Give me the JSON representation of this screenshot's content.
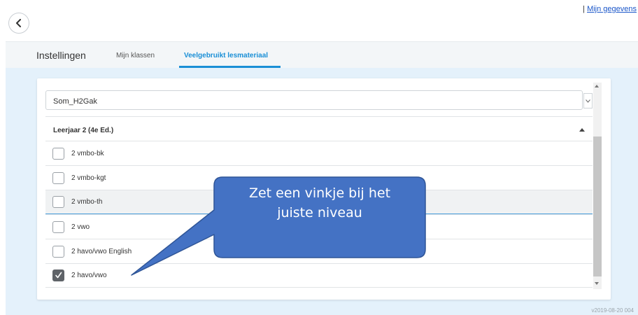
{
  "header": {
    "back_icon": "chevron-left-icon",
    "separator": "|",
    "account_link": "Mijn gegevens"
  },
  "settings": {
    "title": "Instellingen",
    "tabs": [
      {
        "label": "Mijn klassen",
        "active": false
      },
      {
        "label": "Veelgebruikt lesmateriaal",
        "active": true
      }
    ]
  },
  "panel": {
    "select_value": "Som_H2Gak",
    "group_label": "Leerjaar 2 (4e Ed.)",
    "options": [
      {
        "label": "2 vmbo-bk",
        "checked": false
      },
      {
        "label": "2 vmbo-kgt",
        "checked": false
      },
      {
        "label": "2 vmbo-th",
        "checked": false
      },
      {
        "label": "2 vwo",
        "checked": false
      },
      {
        "label": "2 havo/vwo English",
        "checked": false
      },
      {
        "label": "2 havo/vwo",
        "checked": true
      }
    ]
  },
  "callout": {
    "line1": "Zet een vinkje bij het",
    "line2": "juiste niveau"
  },
  "footer": {
    "version": "v2019-08-20 004"
  },
  "colors": {
    "accent": "#1a8fd6",
    "content_bg": "#e4f1fb",
    "callout_fill": "#4472c4",
    "callout_border": "#2f5597"
  }
}
